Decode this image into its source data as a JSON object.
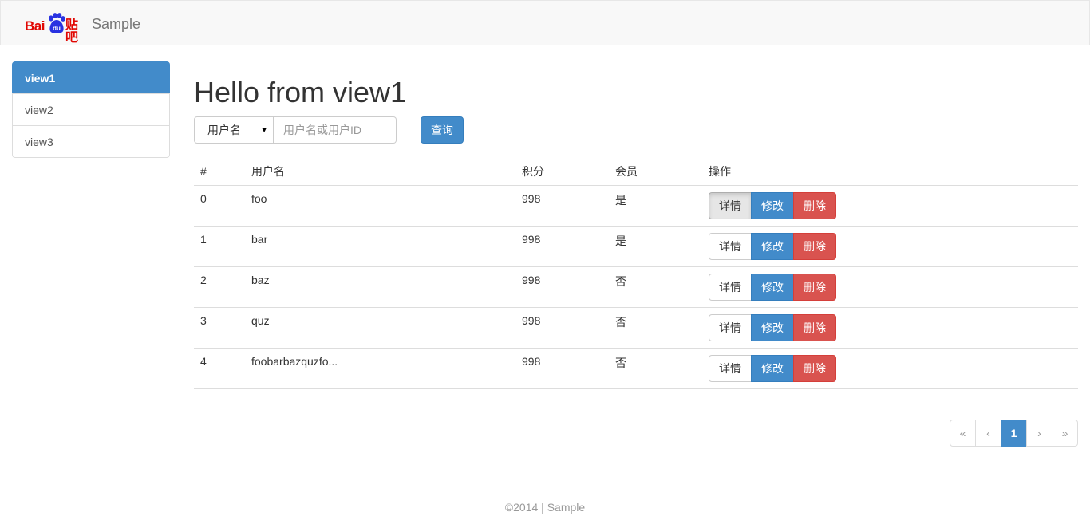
{
  "navbar": {
    "logo_bai": "Bai",
    "logo_du": "du",
    "logo_tieba": "贴吧",
    "brand_text": "Sample"
  },
  "sidebar": {
    "items": [
      {
        "label": "view1",
        "active": true
      },
      {
        "label": "view2",
        "active": false
      },
      {
        "label": "view3",
        "active": false
      }
    ]
  },
  "main": {
    "title": "Hello from view1",
    "search": {
      "select_value": "用户名",
      "placeholder": "用户名或用户ID",
      "query_label": "查询"
    },
    "table": {
      "headers": [
        "#",
        "用户名",
        "积分",
        "会员",
        "操作"
      ],
      "rows": [
        {
          "id": "0",
          "name": "foo",
          "score": "998",
          "member": "是"
        },
        {
          "id": "1",
          "name": "bar",
          "score": "998",
          "member": "是"
        },
        {
          "id": "2",
          "name": "baz",
          "score": "998",
          "member": "否"
        },
        {
          "id": "3",
          "name": "quz",
          "score": "998",
          "member": "否"
        },
        {
          "id": "4",
          "name": "foobarbazquzfo...",
          "score": "998",
          "member": "否"
        }
      ],
      "actions": {
        "detail": "详情",
        "edit": "修改",
        "delete": "删除"
      }
    },
    "pagination": {
      "first": "«",
      "prev": "‹",
      "current": "1",
      "next": "›",
      "last": "»"
    }
  },
  "footer": {
    "text": "©2014 | Sample"
  },
  "colors": {
    "primary": "#428bca",
    "danger": "#d9534f",
    "brand_red": "#e10602"
  }
}
